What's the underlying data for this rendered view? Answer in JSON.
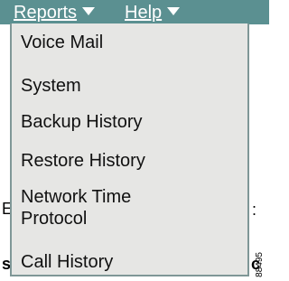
{
  "menubar": {
    "reports_label": "Reports",
    "help_label": "Help"
  },
  "dropdown": {
    "items": [
      {
        "label": "Voice Mail"
      },
      {
        "label": "System"
      },
      {
        "label": "Backup History"
      },
      {
        "label": "Restore History"
      },
      {
        "label": "Network Time Protocol",
        "line1": "Network Time",
        "line2": "Protocol"
      },
      {
        "label": "Call History"
      }
    ]
  },
  "background": {
    "left_fragment_1": "E",
    "left_fragment_2": "s",
    "right_fragment_1": ":",
    "right_fragment_2": "c"
  },
  "figure_id": "88495",
  "colors": {
    "menubar": "#5b9091",
    "dropdown_bg": "#e6e6e4",
    "border": "#7f9797"
  }
}
